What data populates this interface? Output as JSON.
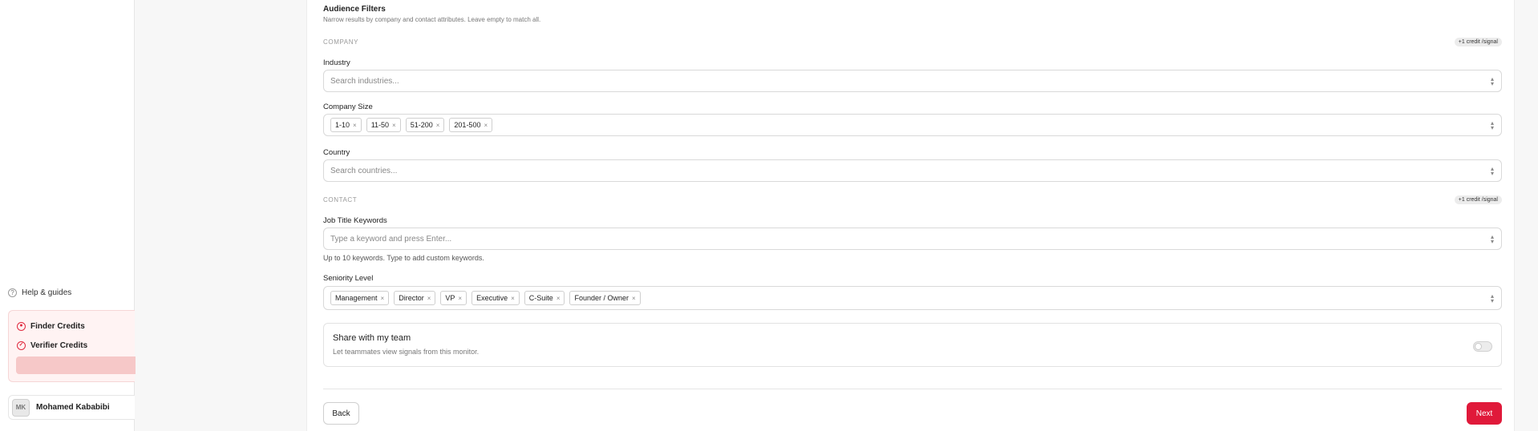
{
  "sidebar": {
    "help_label": "Help & guides",
    "credits": {
      "finder_label": "Finder Credits",
      "verifier_label": "Verifier Credits"
    },
    "user": {
      "initials": "MK",
      "name": "Mohamed Kababibi"
    }
  },
  "filters": {
    "title": "Audience Filters",
    "subtitle": "Narrow results by company and contact attributes. Leave empty to match all.",
    "company": {
      "group_label": "COMPANY",
      "badge": "+1 credit /signal",
      "industry": {
        "label": "Industry",
        "placeholder": "Search industries..."
      },
      "company_size": {
        "label": "Company Size",
        "chips": [
          "1-10",
          "11-50",
          "51-200",
          "201-500"
        ]
      },
      "country": {
        "label": "Country",
        "placeholder": "Search countries..."
      }
    },
    "contact": {
      "group_label": "CONTACT",
      "badge": "+1 credit /signal",
      "job_title": {
        "label": "Job Title Keywords",
        "placeholder": "Type a keyword and press Enter...",
        "hint": "Up to 10 keywords. Type to add custom keywords."
      },
      "seniority": {
        "label": "Seniority Level",
        "chips": [
          "Management",
          "Director",
          "VP",
          "Executive",
          "C-Suite",
          "Founder / Owner"
        ]
      }
    },
    "share": {
      "title": "Share with my team",
      "subtitle": "Let teammates view signals from this monitor."
    }
  },
  "footer": {
    "back_label": "Back",
    "next_label": "Next"
  },
  "colors": {
    "accent": "#e0193a",
    "credit_bar": "#f6c8c8"
  }
}
